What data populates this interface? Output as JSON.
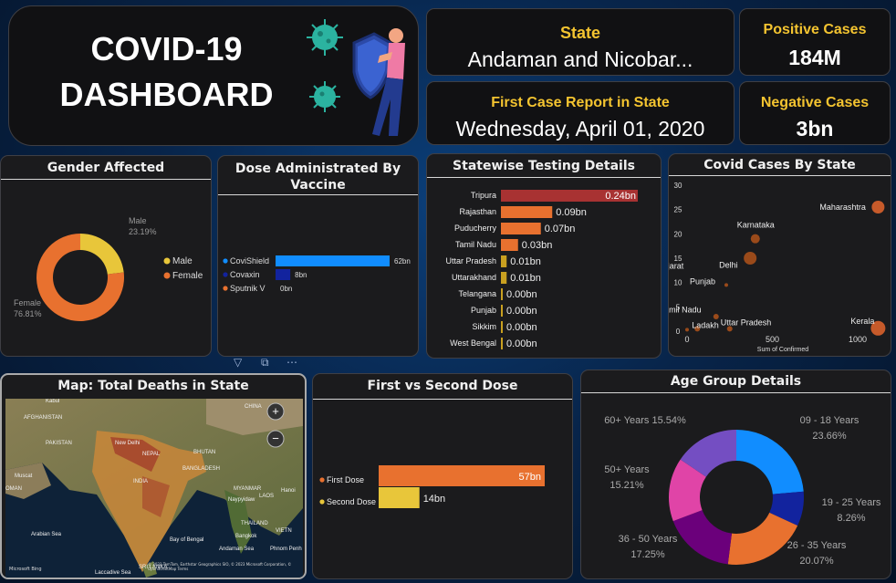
{
  "header": {
    "title_line1": "COVID-19",
    "title_line2": "DASHBOARD"
  },
  "kpis": {
    "state_label": "State",
    "state_value": "Andaman and Nicobar...",
    "positive_label": "Positive Cases",
    "positive_value": "184M",
    "first_case_label": "First Case Report in State",
    "first_case_value": "Wednesday, April 01, 2020",
    "negative_label": "Negative Cases",
    "negative_value": "3bn"
  },
  "panels": {
    "gender": "Gender Affected",
    "vaccine": "Dose Administrated By Vaccine",
    "testing": "Statewise Testing Details",
    "cases": "Covid Cases By State",
    "map": "Map: Total Deaths in State",
    "dose": "First vs Second Dose",
    "age": "Age Group Details"
  },
  "colors": {
    "orange": "#e8712f",
    "yellow": "#e8c63a",
    "crimson": "#a83232",
    "blue": "#118dff",
    "navy": "#12239e",
    "purple": "#6b007b",
    "magenta": "#e044a7",
    "violet": "#744ec2"
  },
  "chart_data": [
    {
      "type": "pie",
      "name": "gender-donut",
      "categories": [
        "Male",
        "Female"
      ],
      "values": [
        23.19,
        76.81
      ],
      "labels": [
        "Male\n23.19%",
        "Female\n76.81%"
      ],
      "colors": [
        "#e8c63a",
        "#e8712f"
      ],
      "legend": [
        "Male",
        "Female"
      ],
      "legend_placement": "right"
    },
    {
      "type": "bar",
      "name": "vaccine-bars",
      "orientation": "horizontal",
      "categories": [
        "CoviShield",
        "Covaxin",
        "Sputnik V"
      ],
      "values": [
        62,
        8,
        0
      ],
      "labels": [
        "62bn",
        "8bn",
        "0bn"
      ],
      "colors": [
        "#118dff",
        "#12239e",
        "#e8712f"
      ]
    },
    {
      "type": "bar",
      "name": "testing-bars",
      "orientation": "horizontal",
      "categories": [
        "Tripura",
        "Rajasthan",
        "Puducherry",
        "Tamil Nadu",
        "Uttar Pradesh",
        "Uttarakhand",
        "Telangana",
        "Punjab",
        "Sikkim",
        "West Bengal"
      ],
      "values": [
        0.24,
        0.09,
        0.07,
        0.03,
        0.01,
        0.01,
        0.0,
        0.0,
        0.0,
        0.0
      ],
      "labels": [
        "0.24bn",
        "0.09bn",
        "0.07bn",
        "0.03bn",
        "0.01bn",
        "0.01bn",
        "0.00bn",
        "0.00bn",
        "0.00bn",
        "0.00bn"
      ]
    },
    {
      "type": "scatter",
      "name": "cases-scatter",
      "xlabel": "Sum of Confirmed",
      "xlim": [
        0,
        1150
      ],
      "ylim": [
        0,
        30
      ],
      "xticks": [
        0,
        500,
        1000
      ],
      "yticks": [
        0,
        5,
        10,
        15,
        20,
        25,
        30
      ],
      "points": [
        {
          "label": "Maharashtra",
          "x": 1120,
          "y": 25.5,
          "r": 7
        },
        {
          "label": "Karnataka",
          "x": 400,
          "y": 19,
          "r": 5
        },
        {
          "label": "",
          "x": 370,
          "y": 15,
          "r": 7
        },
        {
          "label": "Gujarat",
          "x": 0,
          "y": 0,
          "r": 0
        },
        {
          "label": "Delhi",
          "x": 0,
          "y": 0,
          "r": 0
        },
        {
          "label": "Punjab",
          "x": 230,
          "y": 9.5,
          "r": 2
        },
        {
          "label": "Tamil Nadu",
          "x": 0,
          "y": 0,
          "r": 0
        },
        {
          "label": "",
          "x": 170,
          "y": 3,
          "r": 3
        },
        {
          "label": "Ladakh",
          "x": 60,
          "y": 0.5,
          "r": 3
        },
        {
          "label": "",
          "x": 0,
          "y": 0.3,
          "r": 2
        },
        {
          "label": "Uttar Pradesh",
          "x": 250,
          "y": 0.5,
          "r": 3
        },
        {
          "label": "Kerala",
          "x": 1120,
          "y": 0.6,
          "r": 8
        }
      ]
    },
    {
      "type": "bar",
      "name": "dose-bars",
      "orientation": "horizontal",
      "categories": [
        "First Dose",
        "Second Dose"
      ],
      "values": [
        57,
        14
      ],
      "labels": [
        "57bn",
        "14bn"
      ],
      "colors": [
        "#e8712f",
        "#e8c63a"
      ]
    },
    {
      "type": "pie",
      "name": "age-donut",
      "categories": [
        "09 - 18 Years",
        "19 - 25 Years",
        "26 - 35 Years",
        "36 - 50 Years",
        "50+ Years",
        "60+ Years"
      ],
      "values": [
        23.66,
        8.26,
        20.07,
        17.25,
        15.21,
        15.54
      ],
      "labels": [
        "09 - 18 Years\n23.66%",
        "19 - 25 Years\n8.26%",
        "26 - 35 Years\n20.07%",
        "36 - 50 Years\n17.25%",
        "50+ Years\n15.21%",
        "60+ Years 15.54%"
      ],
      "colors": [
        "#118dff",
        "#12239e",
        "#e8712f",
        "#6b007b",
        "#e044a7",
        "#744ec2"
      ]
    }
  ],
  "map": {
    "labels": [
      "Kabul",
      "AFGHANISTAN",
      "PAKISTAN",
      "New Delhi",
      "CHINA",
      "NEPAL",
      "BHUTAN",
      "BANGLADESH",
      "MYANMAR",
      "Muscat",
      "OMAN",
      "INDIA",
      "LAOS",
      "Hanoi",
      "Naypyidaw",
      "THAILAND",
      "Bangkok",
      "Arabian Sea",
      "Bay of Bengal",
      "Andaman Sea",
      "SRI LANKA",
      "Laccadive Sea",
      "Phnom Penh",
      "VIETN"
    ],
    "attribution": "© 2023 TomTom, Earthstar Geographics SIO, © 2023 Microsoft Corporation, © OpenStreetMap Terms",
    "brand": "Microsoft Bing"
  }
}
